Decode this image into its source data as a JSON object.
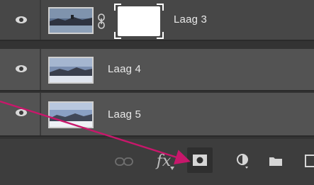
{
  "layers": [
    {
      "name": "Laag 3",
      "has_mask": true,
      "selected": true
    },
    {
      "name": "Laag 4",
      "has_mask": false,
      "selected": false
    },
    {
      "name": "Laag 5",
      "has_mask": false,
      "selected": false
    }
  ],
  "toolbar": {
    "buttons": [
      {
        "icon": "link-layers-icon",
        "label": ""
      },
      {
        "icon": "fx-icon",
        "label": "fx"
      },
      {
        "icon": "add-layer-mask-icon",
        "label": ""
      },
      {
        "icon": "adjustment-layer-icon",
        "label": ""
      },
      {
        "icon": "new-group-folder-icon",
        "label": ""
      },
      {
        "icon": "new-layer-icon",
        "label": ""
      }
    ]
  },
  "annotation": {
    "color": "#c8176b",
    "points_to": "add-layer-mask-button"
  },
  "colors": {
    "panel_bg": "#535353",
    "selected_row_bg": "#474747",
    "toolbar_bg": "#3d3d3d",
    "text": "#e8e8e8"
  }
}
